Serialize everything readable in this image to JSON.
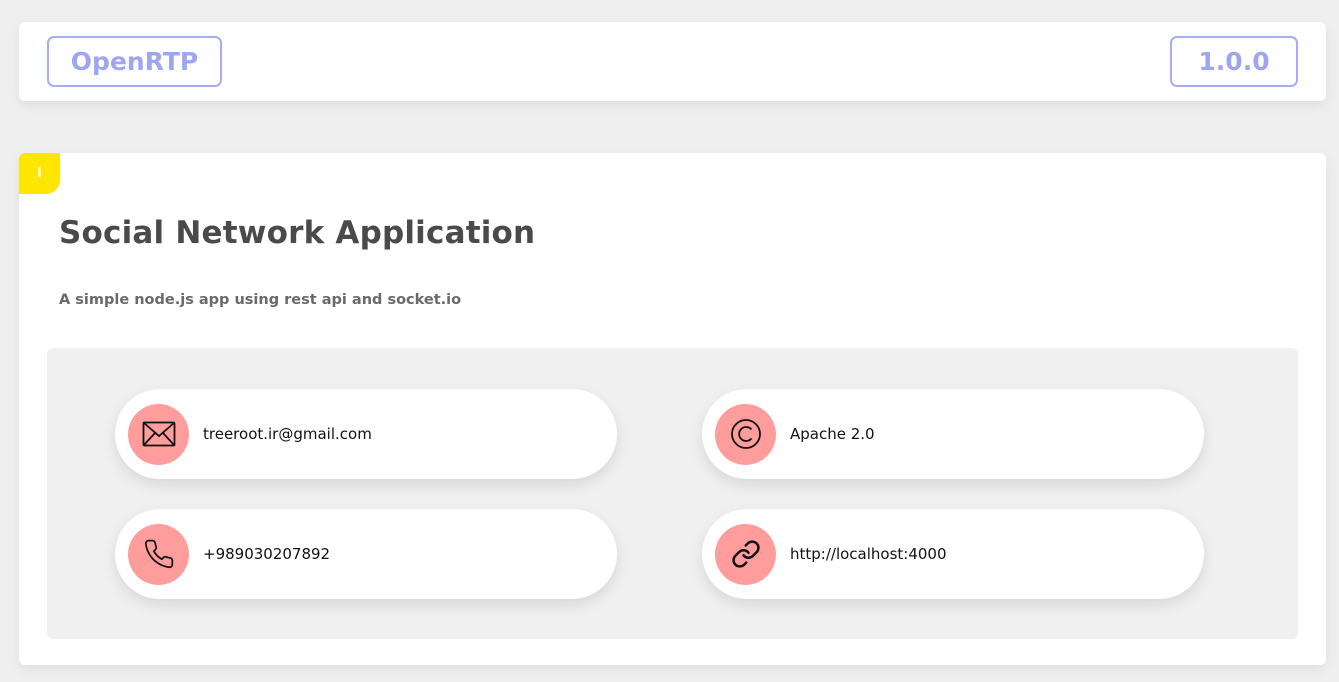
{
  "header": {
    "app_name": "OpenRTP",
    "version": "1.0.0",
    "accent_color": "#9ea6f0"
  },
  "card": {
    "badge_label": "i",
    "badge_color": "#ffe600",
    "title": "Social Network Application",
    "description": "A simple node.js app using rest api and socket.io"
  },
  "contacts": [
    {
      "icon": "envelope-icon",
      "value": "treeroot.ir@gmail.com"
    },
    {
      "icon": "copyright-icon",
      "value": "Apache 2.0"
    },
    {
      "icon": "phone-icon",
      "value": "+989030207892"
    },
    {
      "icon": "link-icon",
      "value": "http://localhost:4000"
    }
  ],
  "icon_bg_color": "#ff9d9d"
}
